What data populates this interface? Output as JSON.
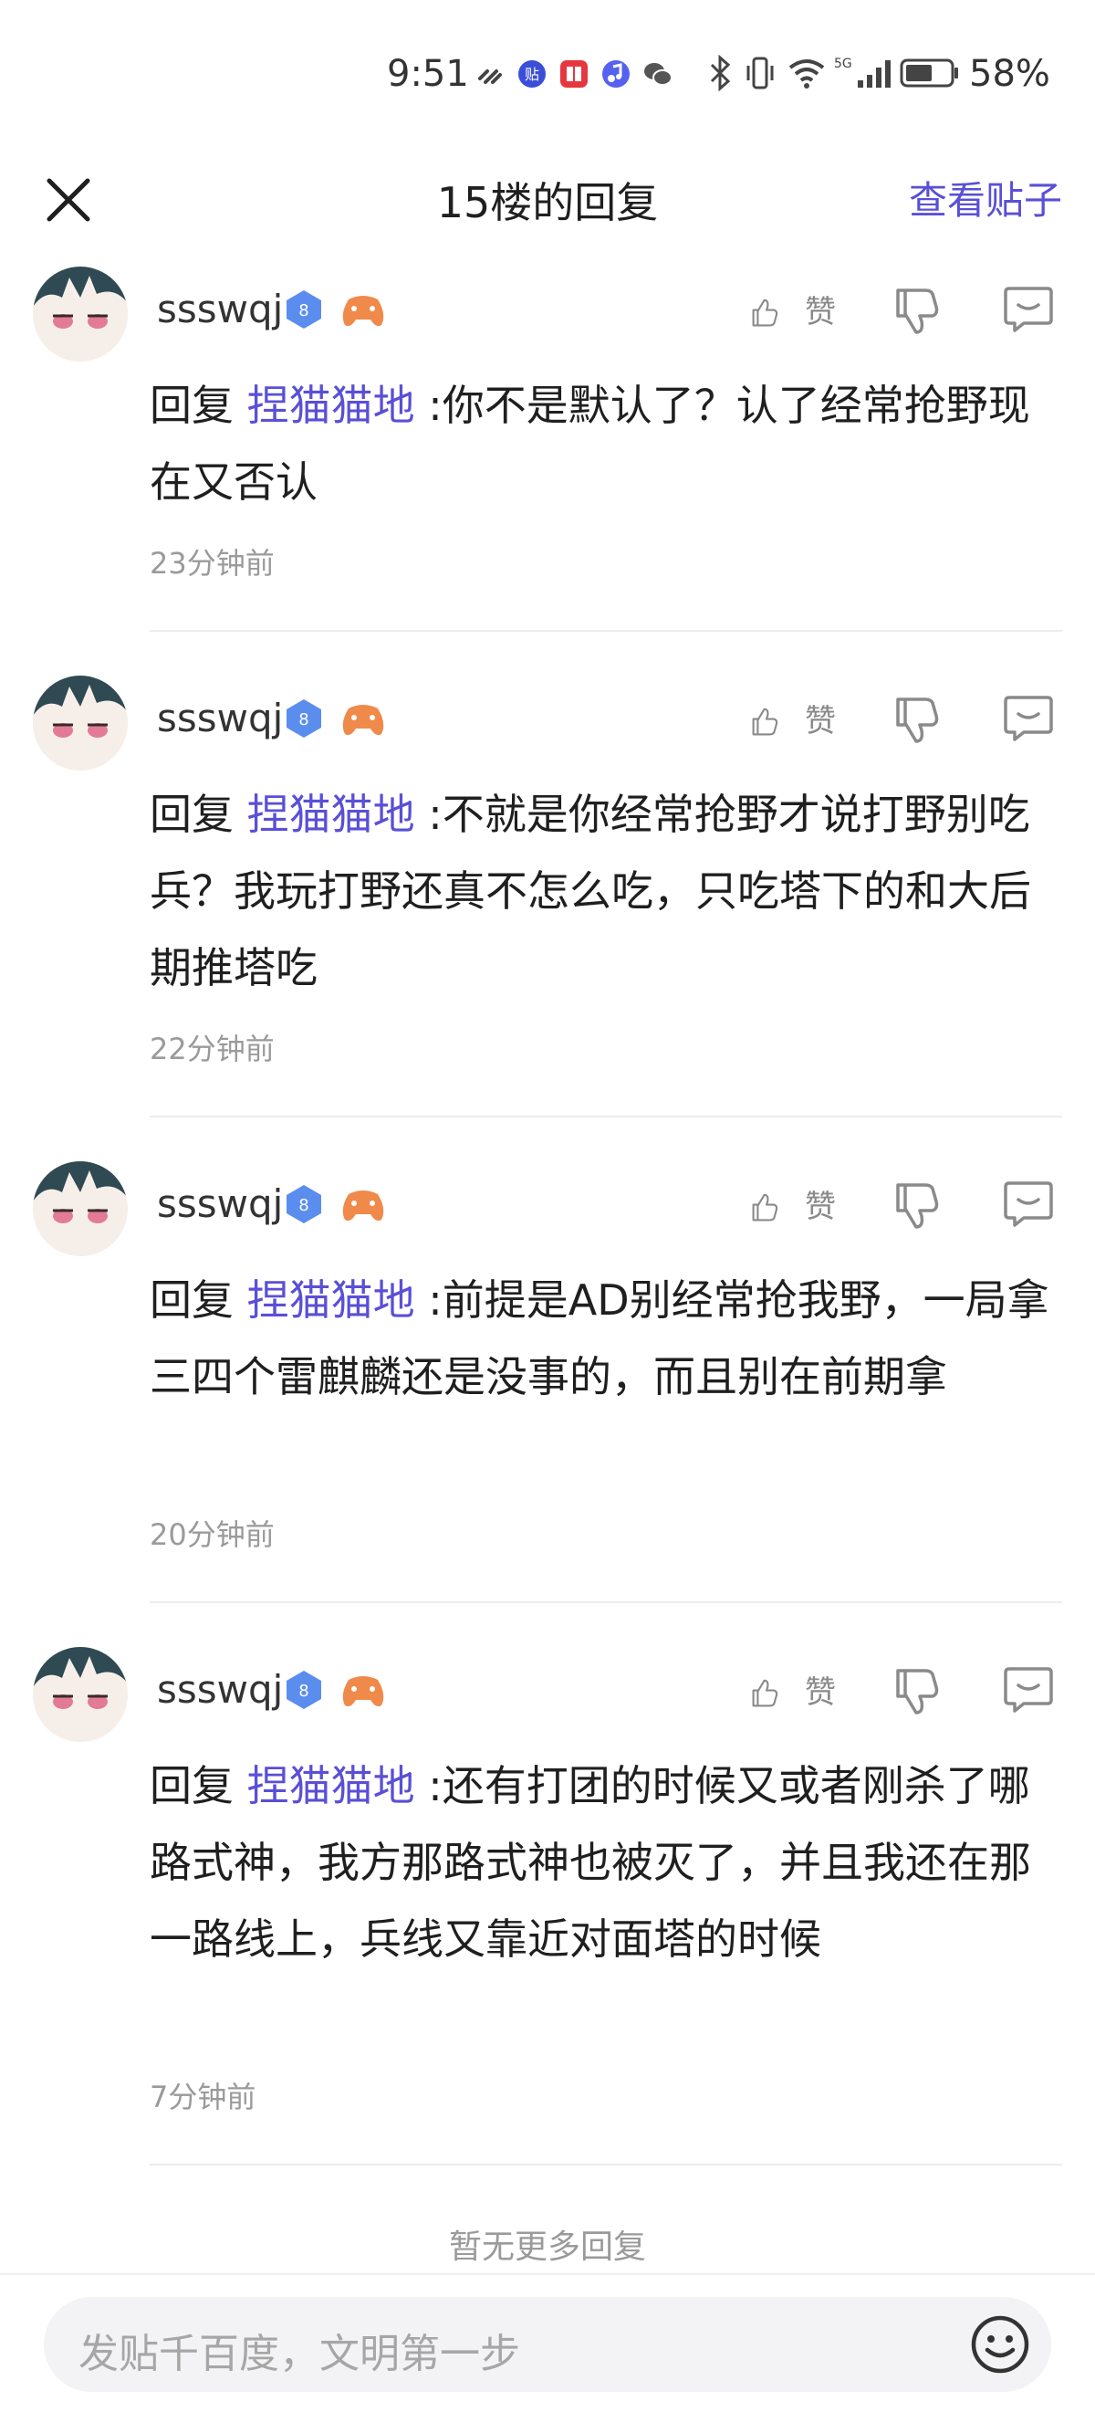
{
  "status_bar": {
    "time": "9:51",
    "battery": "58%",
    "notification_icons": [
      "link-icon",
      "tieba-icon",
      "book-icon",
      "music-icon",
      "wechat-icon"
    ],
    "system_icons": [
      "bluetooth-icon",
      "vibrate-icon",
      "wifi-icon",
      "5g-signal-icon",
      "battery-icon"
    ]
  },
  "header": {
    "title": "15楼的回复",
    "view_post": "查看贴子"
  },
  "comments": [
    {
      "username": "ssswqj",
      "level": "8",
      "like_label": "赞",
      "reply_prefix": "回复",
      "mention": "捏猫猫地",
      "text": ":你不是默认了？认了经常抢野现在又否认",
      "time": "23分钟前"
    },
    {
      "username": "ssswqj",
      "level": "8",
      "like_label": "赞",
      "reply_prefix": "回复",
      "mention": "捏猫猫地",
      "text": ":不就是你经常抢野才说打野别吃兵？我玩打野还真不怎么吃，只吃塔下的和大后期推塔吃",
      "time": "22分钟前"
    },
    {
      "username": "ssswqj",
      "level": "8",
      "like_label": "赞",
      "reply_prefix": "回复",
      "mention": "捏猫猫地",
      "text": ":前提是AD别经常抢我野，一局拿三四个雷麒麟还是没事的，而且别在前期拿",
      "time": "20分钟前"
    },
    {
      "username": "ssswqj",
      "level": "8",
      "like_label": "赞",
      "reply_prefix": "回复",
      "mention": "捏猫猫地",
      "text": ":还有打团的时候又或者刚杀了哪路式神，我方那路式神也被灭了，并且我还在那一路线上，兵线又靠近对面塔的时候",
      "time": "7分钟前"
    }
  ],
  "footer": {
    "no_more": "暂无更多回复",
    "input_placeholder": "发贴千百度，文明第一步"
  },
  "colors": {
    "accent": "#5a4fd6",
    "level_badge": "#5b8def",
    "game_badge": "#f08a4b"
  }
}
